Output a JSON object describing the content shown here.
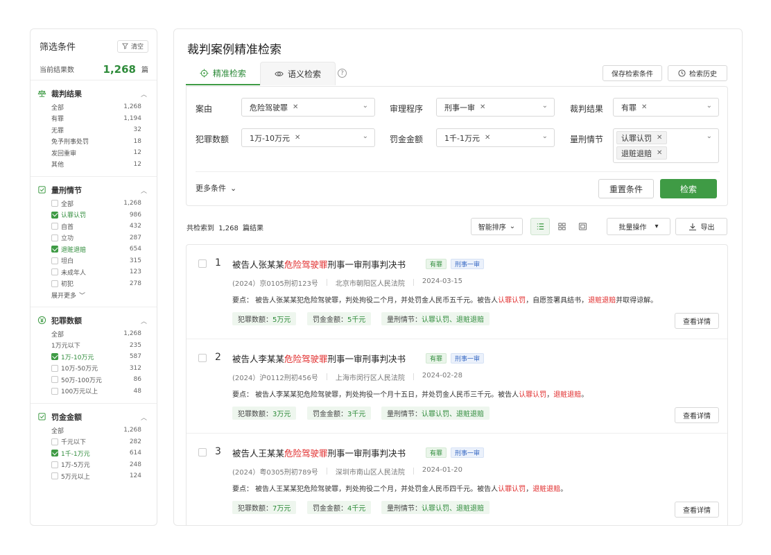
{
  "sidebar": {
    "title": "筛选条件",
    "clear_label": "清空",
    "count_label": "当前结果数",
    "count_value": "1,268",
    "count_unit": "篇",
    "sections": [
      {
        "name": "裁判结果",
        "items": [
          {
            "label": "全部",
            "count": "1,268"
          },
          {
            "label": "有罪",
            "count": "1,194"
          },
          {
            "label": "无罪",
            "count": "32"
          },
          {
            "label": "免予刑事处罚",
            "count": "18"
          },
          {
            "label": "发回重审",
            "count": "12"
          },
          {
            "label": "其他",
            "count": "12"
          }
        ]
      },
      {
        "name": "量刑情节",
        "items": [
          {
            "label": "全部",
            "count": "1,268",
            "checked": false
          },
          {
            "label": "认罪认罚",
            "count": "986",
            "checked": true
          },
          {
            "label": "自首",
            "count": "432",
            "checked": false
          },
          {
            "label": "立功",
            "count": "287",
            "checked": false
          },
          {
            "label": "退赃退赔",
            "count": "654",
            "checked": true
          },
          {
            "label": "坦白",
            "count": "315",
            "checked": false
          },
          {
            "label": "未成年人",
            "count": "123",
            "checked": false
          },
          {
            "label": "初犯",
            "count": "278",
            "checked": false
          }
        ],
        "more_label": "展开更多"
      },
      {
        "name": "犯罪数额",
        "items": [
          {
            "label": "全部",
            "count": "1,268"
          },
          {
            "label": "1万元以下",
            "count": "235"
          },
          {
            "label": "1万-10万元",
            "count": "587",
            "checked": true
          },
          {
            "label": "10万-50万元",
            "count": "312",
            "checked": false
          },
          {
            "label": "50万-100万元",
            "count": "86",
            "checked": false
          },
          {
            "label": "100万元以上",
            "count": "48",
            "checked": false
          }
        ]
      },
      {
        "name": "罚金金额",
        "items": [
          {
            "label": "全部",
            "count": "1,268"
          },
          {
            "label": "千元以下",
            "count": "282",
            "checked": false
          },
          {
            "label": "1千-1万元",
            "count": "614",
            "checked": true
          },
          {
            "label": "1万-5万元",
            "count": "248",
            "checked": false
          },
          {
            "label": "5万元以上",
            "count": "124",
            "checked": false
          }
        ]
      }
    ]
  },
  "main": {
    "title": "裁判案例精准检索",
    "tabs": [
      {
        "label": "精准检索",
        "icon": "target-icon"
      },
      {
        "label": "语义检索",
        "icon": "semantic-icon"
      }
    ],
    "help_glyph": "?",
    "save_conditions_label": "保存检索条件",
    "history_label": "检索历史",
    "filters": {
      "cause_label": "案由",
      "cause_tags": [
        "危险驾驶罪"
      ],
      "procedure_label": "审理程序",
      "procedure_tags": [
        "刑事一审"
      ],
      "result_label": "裁判结果",
      "result_tags": [
        "有罪"
      ],
      "amount_label": "犯罪数额",
      "amount_tags": [
        "1万-10万元"
      ],
      "fine_label": "罚金金额",
      "fine_tags": [
        "1千-1万元"
      ],
      "circumstance_label": "量刑情节",
      "circumstance_tags": [
        "认罪认罚",
        "退赃退赔"
      ]
    },
    "more_conditions_label": "更多条件",
    "reset_label": "重置条件",
    "search_label": "检索",
    "results_prefix": "共检索到",
    "results_count": "1,268",
    "results_suffix": "篇结果",
    "sort_label": "智能排序",
    "batch_label": "批量操作",
    "export_label": "导出"
  },
  "cases": [
    {
      "index": "1",
      "title_pre": "被告人张某某",
      "title_hl": "危险驾驶罪",
      "title_post": "刑事一审刑事判决书",
      "badge_result": "有罪",
      "badge_procedure": "刑事一审",
      "case_no": "(2024）京0105刑初123号",
      "court": "北京市朝阳区人民法院",
      "date": "2024-03-15",
      "abstract_a": "要点：  被告人张某某犯危险驾驶罪，判处拘役二个月，并处罚金人民币五千元。被告人",
      "abstract_r1": "认罪认罚",
      "abstract_b": "，自愿签署具结书，",
      "abstract_r2": "退赃退赔",
      "abstract_c": "并取得谅解。",
      "amount_label": "犯罪数额：",
      "amount_value": "5万元",
      "fine_label": "罚金金额：",
      "fine_value": "5千元",
      "circ_label": "量刑情节：",
      "circ_value": "认罪认罚、退赃退赔",
      "detail_label": "查看详情"
    },
    {
      "index": "2",
      "title_pre": "被告人李某某",
      "title_hl": "危险驾驶罪",
      "title_post": "刑事一审刑事判决书",
      "badge_result": "有罪",
      "badge_procedure": "刑事一审",
      "case_no": "(2024）沪0112刑初456号",
      "court": "上海市闵行区人民法院",
      "date": "2024-02-28",
      "abstract_a": "要点：  被告人李某某犯危险驾驶罪，判处拘役一个月十五日，并处罚金人民币三千元。被告人",
      "abstract_r1": "认罪认罚",
      "abstract_b": "，",
      "abstract_r2": "退赃退赔",
      "abstract_c": "。",
      "amount_label": "犯罪数额：",
      "amount_value": "3万元",
      "fine_label": "罚金金额：",
      "fine_value": "3千元",
      "circ_label": "量刑情节：",
      "circ_value": "认罪认罚、退赃退赔",
      "detail_label": "查看详情"
    },
    {
      "index": "3",
      "title_pre": "被告人王某某",
      "title_hl": "危险驾驶罪",
      "title_post": "刑事一审刑事判决书",
      "badge_result": "有罪",
      "badge_procedure": "刑事一审",
      "case_no": "(2024）粤0305刑初789号",
      "court": "深圳市南山区人民法院",
      "date": "2024-01-20",
      "abstract_a": "要点：  被告人王某某犯危险驾驶罪，判处拘役二个月，并处罚金人民币四千元。被告人",
      "abstract_r1": "认罪认罚",
      "abstract_b": "，",
      "abstract_r2": "退赃退赔",
      "abstract_c": "。",
      "amount_label": "犯罪数额：",
      "amount_value": "7万元",
      "fine_label": "罚金金额：",
      "fine_value": "4千元",
      "circ_label": "量刑情节：",
      "circ_value": "认罪认罚、退赃退赔",
      "detail_label": "查看详情"
    }
  ],
  "colors": {
    "accent": "#3f9b45",
    "highlight": "#e02828",
    "badge_blue": "#3a6bc4"
  }
}
